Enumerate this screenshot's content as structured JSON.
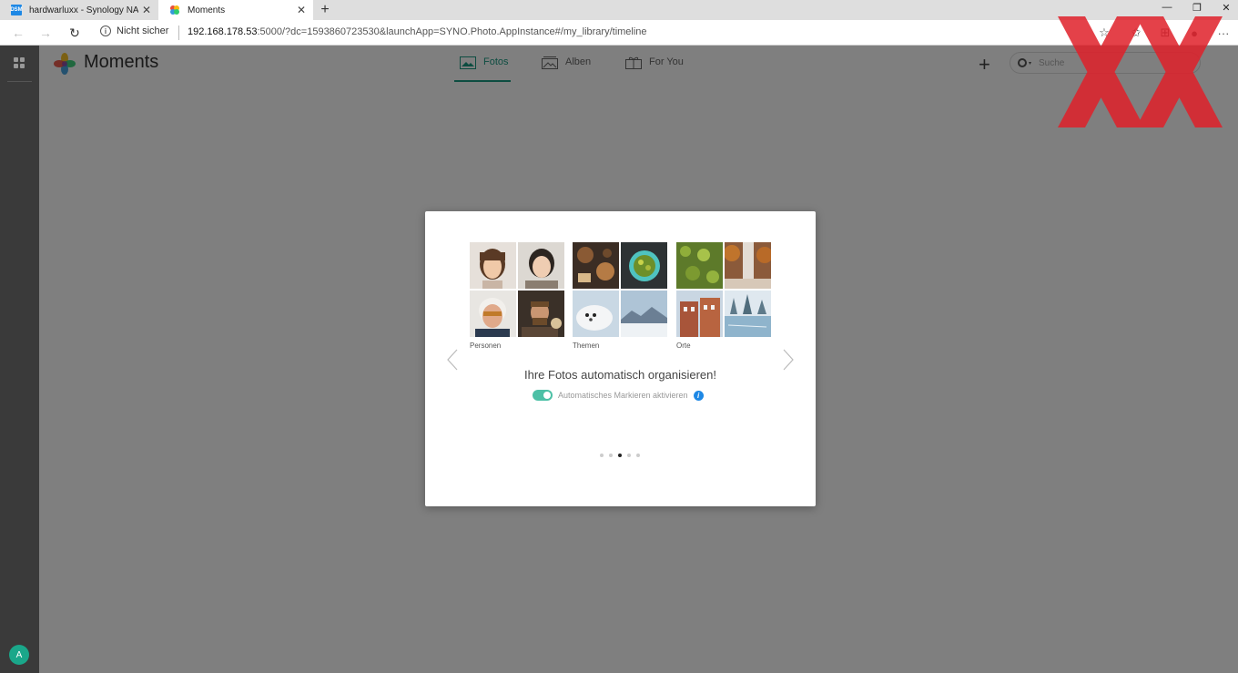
{
  "browser": {
    "tabs": [
      {
        "title": "hardwarluxx - Synology NAS",
        "favicon": "DSM"
      },
      {
        "title": "Moments",
        "favicon": "moments-logo"
      }
    ],
    "close_glyph": "✕",
    "new_tab_glyph": "+",
    "window_controls": {
      "minimize": "—",
      "restore": "❐",
      "close": "✕"
    },
    "nav": {
      "back": "←",
      "forward": "→",
      "reload": "↻"
    },
    "security_label": "Nicht sicher",
    "url": {
      "host": "192.168.178.53",
      "rest": ":5000/?dc=1593860723530&launchApp=SYNO.Photo.AppInstance#/my_library/timeline"
    },
    "toolbar_icons": {
      "favorite": "☆",
      "favorites": "✩",
      "collections": "⊞",
      "profile": "●",
      "menu": "···"
    }
  },
  "sidebar": {
    "avatar_initial": "A"
  },
  "app": {
    "title": "Moments",
    "tabs": [
      {
        "label": "Fotos",
        "active": true
      },
      {
        "label": "Alben",
        "active": false
      },
      {
        "label": "For You",
        "active": false
      }
    ],
    "add_glyph": "+",
    "search_placeholder": "Suche",
    "search_caret": "▾"
  },
  "modal": {
    "groups": [
      {
        "caption": "Personen"
      },
      {
        "caption": "Themen"
      },
      {
        "caption": "Orte"
      }
    ],
    "headline": "Ihre Fotos automatisch organisieren!",
    "toggle": {
      "label": "Automatisches Markieren aktivieren",
      "on": true
    },
    "info_glyph": "i",
    "pager": {
      "count": 5,
      "active": 3
    }
  },
  "colors": {
    "accent": "#1b9a83",
    "toggle": "#4dc0a6",
    "info": "#1e88e5",
    "watermark": "#e0202a"
  }
}
